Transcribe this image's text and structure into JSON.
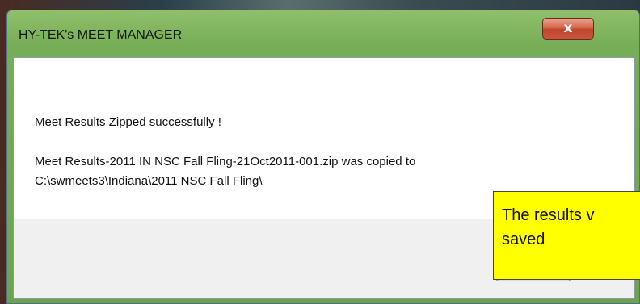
{
  "window": {
    "title": "HY-TEK's MEET MANAGER",
    "close_label": "x",
    "close_icon": "close-icon"
  },
  "message": {
    "line1": "Meet Results Zipped successfully !",
    "line2": "Meet Results-2011 IN NSC Fall Fling-21Oct2011-001.zip was copied to",
    "line3": "C:\\swmeets3\\Indiana\\2011 NSC Fall Fling\\"
  },
  "annotation": {
    "line1": "The results v",
    "line2": "saved",
    "color": "#ffff00"
  }
}
